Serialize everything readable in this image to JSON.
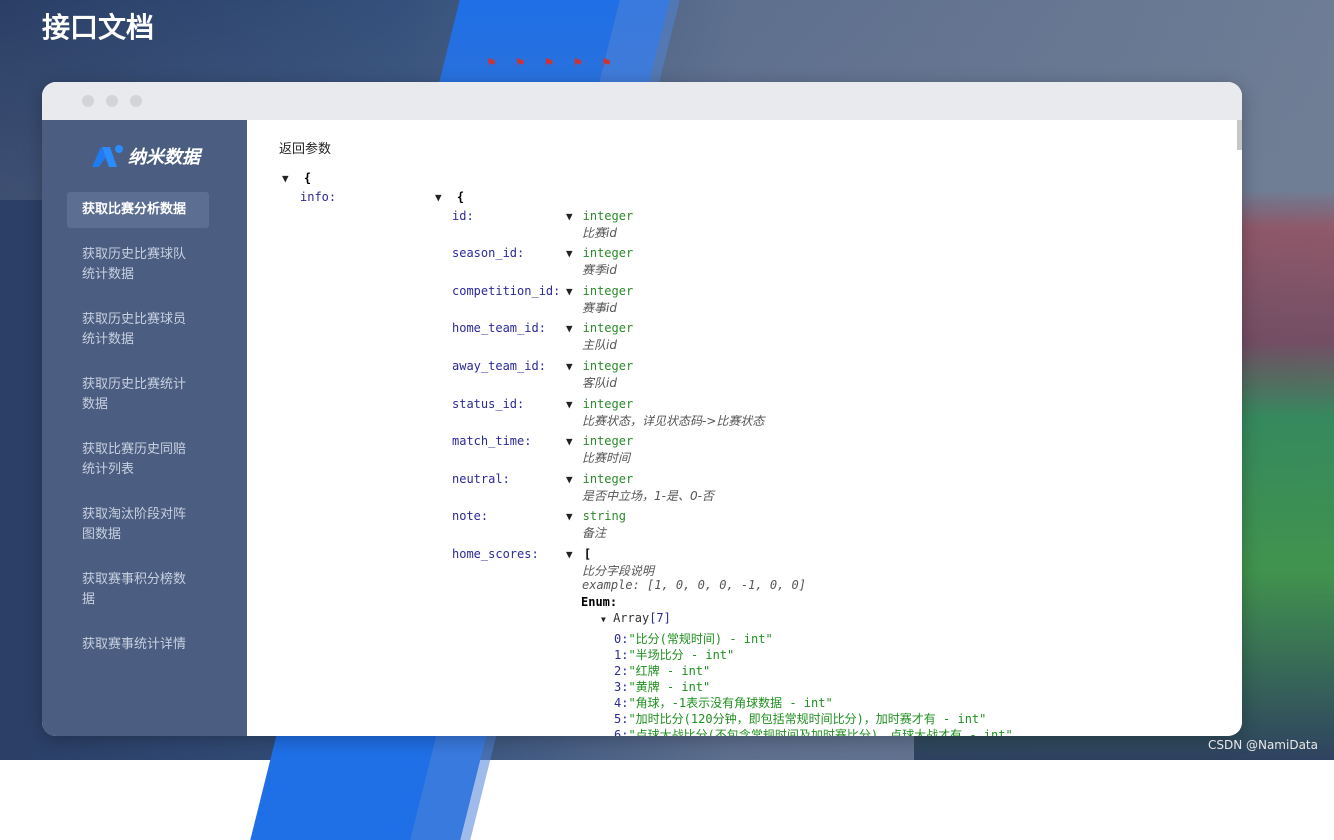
{
  "page": {
    "title": "接口文档",
    "watermark": "CSDN @NamiData"
  },
  "colors": {
    "accent": "#1f6fe6",
    "sidebar": "#4b5e82",
    "key": "#2a2a9a",
    "type": "#2b8a2b"
  },
  "logo": {
    "text": "纳米数据",
    "icon": "nami-logo-icon"
  },
  "sidebar": {
    "items": [
      {
        "label": "获取比赛分析数据",
        "active": true
      },
      {
        "label": "获取历史比赛球队统计数据",
        "active": false
      },
      {
        "label": "获取历史比赛球员统计数据",
        "active": false
      },
      {
        "label": "获取历史比赛统计数据",
        "active": false
      },
      {
        "label": "获取比赛历史同赔统计列表",
        "active": false
      },
      {
        "label": "获取淘汰阶段对阵图数据",
        "active": false
      },
      {
        "label": "获取赛事积分榜数据",
        "active": false
      },
      {
        "label": "获取赛事统计详情",
        "active": false
      }
    ]
  },
  "content": {
    "section_title": "返回参数",
    "root_brace": "{",
    "info_key": "info:",
    "info_brace": "{",
    "fields": [
      {
        "key": "id:",
        "type": "integer",
        "desc": "比赛id"
      },
      {
        "key": "season_id:",
        "type": "integer",
        "desc": "赛季id"
      },
      {
        "key": "competition_id:",
        "type": "integer",
        "desc": "赛事id"
      },
      {
        "key": "home_team_id:",
        "type": "integer",
        "desc": "主队id"
      },
      {
        "key": "away_team_id:",
        "type": "integer",
        "desc": "客队id"
      },
      {
        "key": "status_id:",
        "type": "integer",
        "desc": "比赛状态，详见状态码->比赛状态"
      },
      {
        "key": "match_time:",
        "type": "integer",
        "desc": "比赛时间"
      },
      {
        "key": "neutral:",
        "type": "integer",
        "desc": "是否中立场，1-是、0-否"
      },
      {
        "key": "note:",
        "type": "string",
        "desc": "备注"
      }
    ],
    "home_scores": {
      "key": "home_scores:",
      "bracket": "[",
      "desc": "比分字段说明",
      "example": "example: [1, 0, 0, 0, -1, 0, 0]",
      "enum_label": "Enum:",
      "array_label": "Array",
      "array_count": "[7]",
      "items": [
        {
          "idx": "0:",
          "val": "\"比分(常规时间) - int\""
        },
        {
          "idx": "1:",
          "val": "\"半场比分 - int\""
        },
        {
          "idx": "2:",
          "val": "\"红牌 - int\""
        },
        {
          "idx": "3:",
          "val": "\"黄牌 - int\""
        },
        {
          "idx": "4:",
          "val": "\"角球，-1表示没有角球数据 - int\""
        },
        {
          "idx": "5:",
          "val": "\"加时比分(120分钟，即包括常规时间比分)，加时赛才有 - int\""
        },
        {
          "idx": "6:",
          "val": "\"点球大战比分(不包含常规时间及加时赛比分)，点球大战才有 - int\""
        }
      ]
    }
  }
}
